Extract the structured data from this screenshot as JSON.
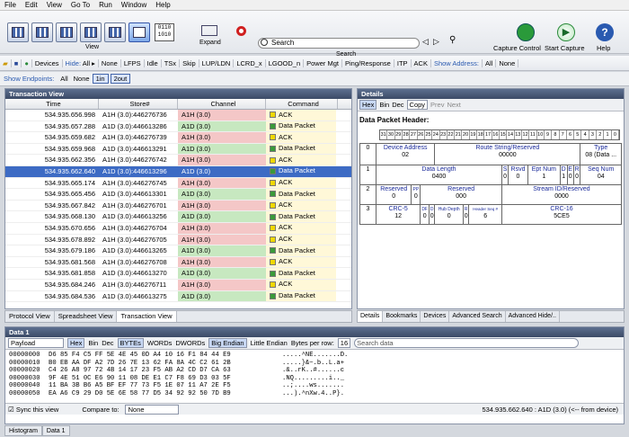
{
  "menu": [
    "File",
    "Edit",
    "View",
    "Go To",
    "Run",
    "Window",
    "Help"
  ],
  "toolbar": {
    "view_label": "View",
    "bits": "0110\n1010",
    "expand_label": "Expand",
    "search_placeholder": "Search",
    "search_label": "Search",
    "capture_control": "Capture Control",
    "start_capture": "Start Capture",
    "help": "Help"
  },
  "toolbar2": {
    "devices": "Devices",
    "hide_label": "Hide:",
    "hide_all": "All",
    "none": "None",
    "items": [
      "LFPS",
      "Idle",
      "TSx",
      "Skip",
      "LUP/LDN",
      "LCRD_x",
      "LGOOD_n",
      "Power Mgt",
      "Ping/Response",
      "ITP",
      "ACK"
    ],
    "show_address": "Show Address:",
    "show_all": "All",
    "show_none": "None"
  },
  "toolbar3": {
    "show_endpoints": "Show Endpoints:",
    "all": "All",
    "none": "None",
    "in1": "1in",
    "out2": "2out"
  },
  "txview": {
    "title": "Transaction View",
    "cols": [
      "Time",
      "Store#",
      "Channel",
      "Command"
    ],
    "rows": [
      {
        "time": "534.935.656.998",
        "store": "A1H (3.0):446276736",
        "ch": "A1H (3.0)",
        "cmd": "ACK",
        "type": "h"
      },
      {
        "time": "534.935.657.288",
        "store": "A1D (3.0):446613286",
        "ch": "A1D (3.0)",
        "cmd": "Data Packet",
        "type": "d"
      },
      {
        "time": "534.935.659.682",
        "store": "A1H (3.0):446276739",
        "ch": "A1H (3.0)",
        "cmd": "ACK",
        "type": "h"
      },
      {
        "time": "534.935.659.968",
        "store": "A1D (3.0):446613291",
        "ch": "A1D (3.0)",
        "cmd": "Data Packet",
        "type": "d"
      },
      {
        "time": "534.935.662.356",
        "store": "A1H (3.0):446276742",
        "ch": "A1H (3.0)",
        "cmd": "ACK",
        "type": "h"
      },
      {
        "time": "534.935.662.640",
        "store": "A1D (3.0):446613296",
        "ch": "A1D (3.0)",
        "cmd": "Data Packet",
        "type": "d",
        "sel": true
      },
      {
        "time": "534.935.665.174",
        "store": "A1H (3.0):446276745",
        "ch": "A1H (3.0)",
        "cmd": "ACK",
        "type": "h"
      },
      {
        "time": "534.935.665.456",
        "store": "A1D (3.0):446613301",
        "ch": "A1D (3.0)",
        "cmd": "Data Packet",
        "type": "d"
      },
      {
        "time": "534.935.667.842",
        "store": "A1H (3.0):446276701",
        "ch": "A1H (3.0)",
        "cmd": "ACK",
        "type": "h"
      },
      {
        "time": "534.935.668.130",
        "store": "A1D (3.0):446613256",
        "ch": "A1D (3.0)",
        "cmd": "Data Packet",
        "type": "d"
      },
      {
        "time": "534.935.670.656",
        "store": "A1H (3.0):446276704",
        "ch": "A1H (3.0)",
        "cmd": "ACK",
        "type": "h"
      },
      {
        "time": "534.935.678.892",
        "store": "A1H (3.0):446276705",
        "ch": "A1H (3.0)",
        "cmd": "ACK",
        "type": "h"
      },
      {
        "time": "534.935.679.186",
        "store": "A1D (3.0):446613265",
        "ch": "A1D (3.0)",
        "cmd": "Data Packet",
        "type": "d"
      },
      {
        "time": "534.935.681.568",
        "store": "A1H (3.0):446276708",
        "ch": "A1H (3.0)",
        "cmd": "ACK",
        "type": "h"
      },
      {
        "time": "534.935.681.858",
        "store": "A1D (3.0):446613270",
        "ch": "A1D (3.0)",
        "cmd": "Data Packet",
        "type": "d"
      },
      {
        "time": "534.935.684.246",
        "store": "A1H (3.0):446276711",
        "ch": "A1H (3.0)",
        "cmd": "ACK",
        "type": "h"
      },
      {
        "time": "534.935.684.536",
        "store": "A1D (3.0):446613275",
        "ch": "A1D (3.0)",
        "cmd": "Data Packet",
        "type": "d"
      }
    ],
    "tabs": [
      "Protocol View",
      "Spreadsheet View",
      "Transaction View"
    ]
  },
  "details": {
    "title": "Details",
    "hex": "Hex",
    "bin": "Bin",
    "dec": "Dec",
    "copy": "Copy",
    "prev": "Prev",
    "next": "Next",
    "header": "Data Packet Header:",
    "bits": [
      "31",
      "30",
      "29",
      "28",
      "27",
      "26",
      "25",
      "24",
      "23",
      "22",
      "21",
      "20",
      "19",
      "18",
      "17",
      "16",
      "15",
      "14",
      "13",
      "12",
      "11",
      "10",
      "9",
      "8",
      "7",
      "6",
      "5",
      "4",
      "3",
      "2",
      "1",
      "0"
    ],
    "r0": [
      "0",
      "Device Address",
      "02",
      "Route String/Reserved",
      "00000",
      "Type",
      "08 (Data ..."
    ],
    "r1": [
      "1",
      "Data Length",
      "0400",
      "S",
      "0",
      "Rsvd",
      "0",
      "Ept Num",
      "1",
      "D",
      "1",
      "R",
      "0",
      "Seq Num",
      "04",
      "E",
      "0"
    ],
    "r2": [
      "2",
      "Reserved",
      "0",
      "PP",
      "0",
      "Reserved",
      "000",
      "Stream ID/Reserved",
      "0000"
    ],
    "r3": [
      "3",
      "CRC-5",
      "12",
      "DF",
      "0",
      "D",
      "0",
      "Hub Depth",
      "0",
      "R",
      "0",
      "Header Seq #",
      "6",
      "CRC-16",
      "5CE5"
    ],
    "tabs": [
      "Details",
      "Bookmarks",
      "Devices",
      "Advanced Search",
      "Advanced Hide/.."
    ]
  },
  "data1": {
    "title": "Data 1",
    "mode": "Payload",
    "hex": "Hex",
    "bin": "Bin",
    "dec": "Dec",
    "bytes": "BYTEs",
    "words": "WORDs",
    "dwords": "DWORDs",
    "big": "Big Endian",
    "little": "Little Endian",
    "bpr": "Bytes per row:",
    "bpr_val": "16",
    "search_placeholder": "Search data",
    "lines": [
      {
        "a": "00000000",
        "h": "D6 85 F4 C5 FF 5E 4E 45 0D A4 10 16 F1 84 44 E9",
        "t": ".....^NE.......D."
      },
      {
        "a": "00000010",
        "h": "B0 EB AA DF A2 7D 26 7E 13 62 FA 8A 4C C2 61 2B",
        "t": ".....}&~.b..L.a+"
      },
      {
        "a": "00000020",
        "h": "C4 26 A8 97 72 4B 14 17 23 F5 AB A2 CD D7 CA 63",
        "t": ".&..rK..#......c"
      },
      {
        "a": "00000030",
        "h": "9F 4E 51 0C E6 90 11 08 DE E1 C7 F8 69 D3 03 5F",
        "t": ".NQ.........i.._"
      },
      {
        "a": "00000040",
        "h": "11 BA 3B B6 A5 BF EF 77 73 F5 1E 07 11 A7 2E F5",
        "t": "..;....ws......."
      },
      {
        "a": "00000050",
        "h": "EA A6 C9 29 D0 5E 6E 58 77 D5 34 92 92 50 7D B9",
        "t": "...).^nXw.4..P}."
      }
    ],
    "sync": "Sync this view",
    "compare": "Compare to:",
    "compare_val": "None",
    "status": "534.935.662.640 : A1D (3.0) (<-- from device)"
  },
  "bottomtabs": [
    "Histogram",
    "Data 1"
  ],
  "colors": {
    "ack": "#f4c7c7",
    "data": "#c7e8c0",
    "sel": "#3d6bc4"
  }
}
